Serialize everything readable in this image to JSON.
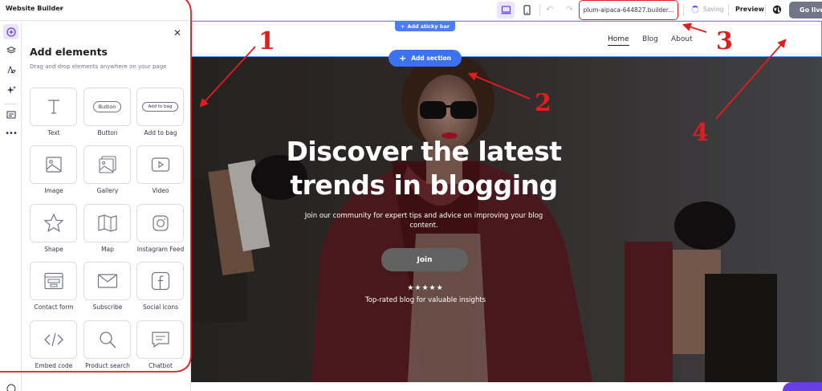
{
  "topbar": {
    "title": "Website Builder",
    "url": "plum-alpaca-644827.builder...",
    "saving_label": "Saving",
    "preview_label": "Preview",
    "golive_label": "Go live"
  },
  "panel": {
    "title": "Add elements",
    "subtitle": "Drag and drop elements anywhere on your page",
    "tiles": [
      {
        "label": "Text",
        "icon": "text-icon"
      },
      {
        "label": "Button",
        "icon": "button-icon",
        "inner": "Button"
      },
      {
        "label": "Add to bag",
        "icon": "add-to-bag-icon",
        "inner": "Add to bag"
      },
      {
        "label": "Image",
        "icon": "image-icon"
      },
      {
        "label": "Gallery",
        "icon": "gallery-icon"
      },
      {
        "label": "Video",
        "icon": "video-icon"
      },
      {
        "label": "Shape",
        "icon": "star-icon"
      },
      {
        "label": "Map",
        "icon": "map-icon"
      },
      {
        "label": "Instagram Feed",
        "icon": "instagram-icon"
      },
      {
        "label": "Contact form",
        "icon": "contact-form-icon"
      },
      {
        "label": "Subscribe",
        "icon": "envelope-icon"
      },
      {
        "label": "Social icons",
        "icon": "facebook-icon"
      },
      {
        "label": "Embed code",
        "icon": "code-icon"
      },
      {
        "label": "Product search",
        "icon": "search-icon"
      },
      {
        "label": "Chatbot",
        "icon": "chat-icon"
      }
    ]
  },
  "canvas": {
    "sticky_bar_label": "Add sticky bar",
    "add_section_label": "Add section",
    "nav": [
      "Home",
      "Blog",
      "About"
    ],
    "hero": {
      "title": "Discover the latest trends in blogging",
      "subtitle": "Join our community for expert tips and advice on improving your blog content.",
      "join_label": "Join",
      "stars": "★★★★★",
      "stars_caption": "Top-rated blog for valuable insights"
    }
  },
  "annotations": [
    "1",
    "2",
    "3",
    "4"
  ],
  "colors": {
    "accent": "#673de6",
    "annotation_red": "#e21d1d",
    "add_section_blue": "#3b73ee"
  }
}
